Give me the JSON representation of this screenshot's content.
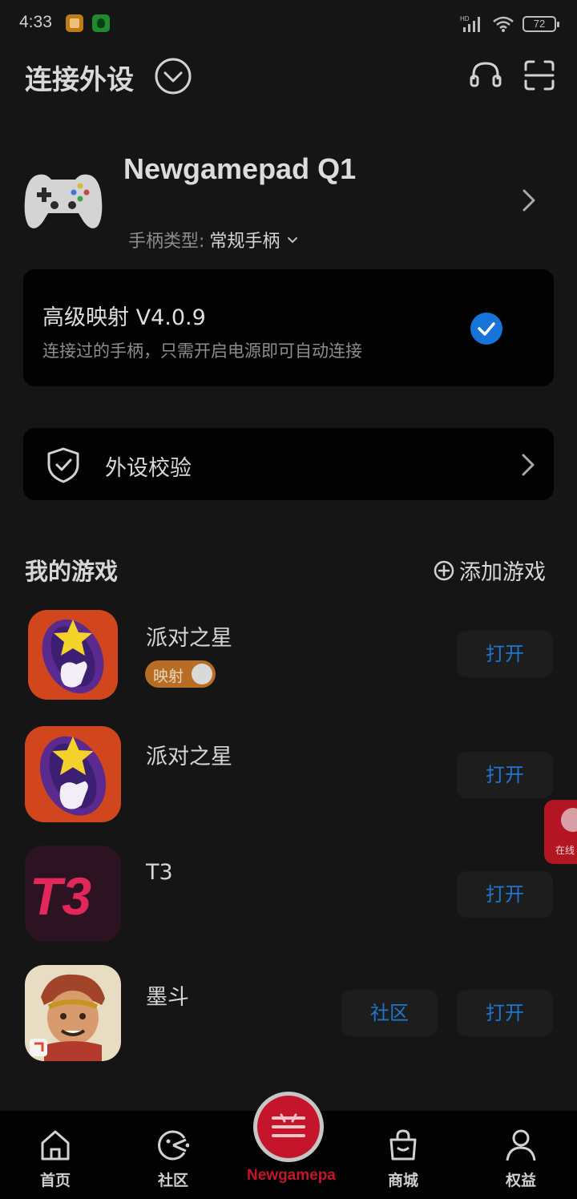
{
  "status_bar": {
    "time": "4:33",
    "network_label": "HD",
    "battery": "72"
  },
  "header": {
    "title": "连接外设"
  },
  "device": {
    "name": "Newgamepad Q1",
    "type_label": "手柄类型:",
    "type_value": "常规手柄"
  },
  "mapping_card": {
    "title": "高级映射 V4.0.9",
    "subtitle": "连接过的手柄，只需开启电源即可自动连接",
    "accent": "#1673d8"
  },
  "verify_card": {
    "label": "外设校验"
  },
  "games": {
    "title": "我的游戏",
    "add_label": "添加游戏",
    "items": [
      {
        "name": "派对之星",
        "mapping_badge": "映射",
        "open": "打开",
        "icon": "party-star-icon"
      },
      {
        "name": "派对之星",
        "open": "打开",
        "icon": "party-star-icon"
      },
      {
        "name": "T3",
        "open": "打开",
        "icon": "t3-logo",
        "logo_text": "T3"
      },
      {
        "name": "墨斗",
        "community": "社区",
        "open": "打开",
        "icon": "modou-icon"
      }
    ]
  },
  "support": {
    "label": "在线"
  },
  "bottom_nav": {
    "items": [
      {
        "label": "首页",
        "icon": "home-icon"
      },
      {
        "label": "社区",
        "icon": "community-icon"
      },
      {
        "label": "Newgamepad",
        "icon": "newgamepad-icon",
        "active": true
      },
      {
        "label": "商城",
        "icon": "shop-bag-icon"
      },
      {
        "label": "权益",
        "icon": "profile-icon"
      }
    ],
    "active_color": "#c4152a"
  }
}
